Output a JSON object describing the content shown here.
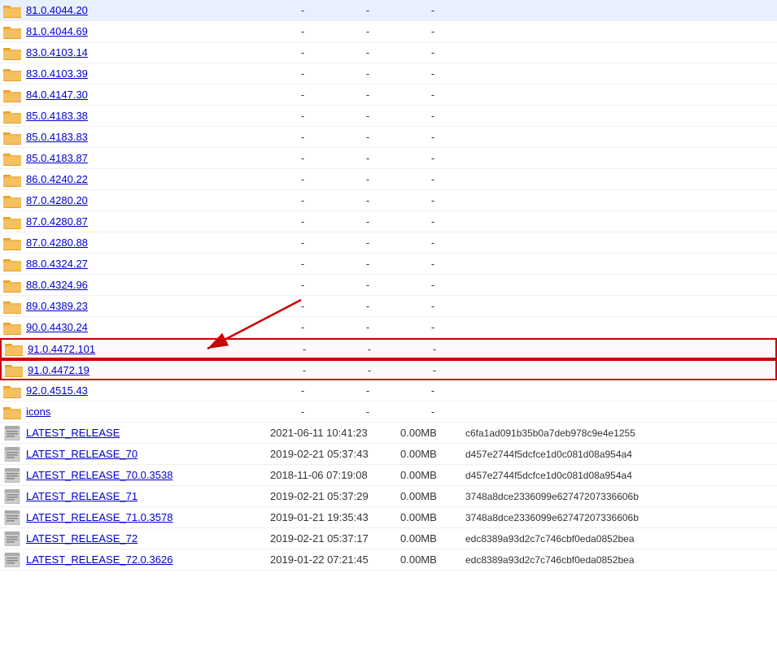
{
  "rows": [
    {
      "type": "folder",
      "name": "81.0.4044.20",
      "date": "",
      "size": "",
      "col3": "-",
      "col4": "-",
      "col5": "-",
      "hash": ""
    },
    {
      "type": "folder",
      "name": "81.0.4044.69",
      "date": "",
      "size": "",
      "col3": "-",
      "col4": "-",
      "col5": "-",
      "hash": ""
    },
    {
      "type": "folder",
      "name": "83.0.4103.14",
      "date": "",
      "size": "",
      "col3": "-",
      "col4": "-",
      "col5": "-",
      "hash": ""
    },
    {
      "type": "folder",
      "name": "83.0.4103.39",
      "date": "",
      "size": "",
      "col3": "-",
      "col4": "-",
      "col5": "-",
      "hash": ""
    },
    {
      "type": "folder",
      "name": "84.0.4147.30",
      "date": "",
      "size": "",
      "col3": "-",
      "col4": "-",
      "col5": "-",
      "hash": ""
    },
    {
      "type": "folder",
      "name": "85.0.4183.38",
      "date": "",
      "size": "",
      "col3": "-",
      "col4": "-",
      "col5": "-",
      "hash": ""
    },
    {
      "type": "folder",
      "name": "85.0.4183.83",
      "date": "",
      "size": "",
      "col3": "-",
      "col4": "-",
      "col5": "-",
      "hash": ""
    },
    {
      "type": "folder",
      "name": "85.0.4183.87",
      "date": "",
      "size": "",
      "col3": "-",
      "col4": "-",
      "col5": "-",
      "hash": ""
    },
    {
      "type": "folder",
      "name": "86.0.4240.22",
      "date": "",
      "size": "",
      "col3": "-",
      "col4": "-",
      "col5": "-",
      "hash": ""
    },
    {
      "type": "folder",
      "name": "87.0.4280.20",
      "date": "",
      "size": "",
      "col3": "-",
      "col4": "-",
      "col5": "-",
      "hash": ""
    },
    {
      "type": "folder",
      "name": "87.0.4280.87",
      "date": "",
      "size": "",
      "col3": "-",
      "col4": "-",
      "col5": "-",
      "hash": ""
    },
    {
      "type": "folder",
      "name": "87.0.4280.88",
      "date": "",
      "size": "",
      "col3": "-",
      "col4": "-",
      "col5": "-",
      "hash": ""
    },
    {
      "type": "folder",
      "name": "88.0.4324.27",
      "date": "",
      "size": "",
      "col3": "-",
      "col4": "-",
      "col5": "-",
      "hash": ""
    },
    {
      "type": "folder",
      "name": "88.0.4324.96",
      "date": "",
      "size": "",
      "col3": "-",
      "col4": "-",
      "col5": "-",
      "hash": ""
    },
    {
      "type": "folder",
      "name": "89.0.4389.23",
      "date": "",
      "size": "",
      "col3": "-",
      "col4": "-",
      "col5": "-",
      "hash": ""
    },
    {
      "type": "folder",
      "name": "90.0.4430.24",
      "date": "",
      "size": "",
      "col3": "-",
      "col4": "-",
      "col5": "-",
      "hash": ""
    },
    {
      "type": "folder",
      "name": "91.0.4472.101",
      "date": "",
      "size": "",
      "col3": "-",
      "col4": "-",
      "col5": "-",
      "hash": "",
      "highlighted": true
    },
    {
      "type": "folder",
      "name": "91.0.4472.19",
      "date": "",
      "size": "",
      "col3": "-",
      "col4": "-",
      "col5": "-",
      "hash": "",
      "highlighted": true
    },
    {
      "type": "folder",
      "name": "92.0.4515.43",
      "date": "",
      "size": "",
      "col3": "-",
      "col4": "-",
      "col5": "-",
      "hash": ""
    },
    {
      "type": "folder",
      "name": "icons",
      "date": "",
      "size": "",
      "col3": "-",
      "col4": "-",
      "col5": "-",
      "hash": ""
    },
    {
      "type": "file",
      "name": "LATEST_RELEASE",
      "date": "2021-06-11 10:41:23",
      "size": "0.00MB",
      "col3": "",
      "col4": "",
      "col5": "",
      "hash": "c6fa1ad091b35b0a7deb978c9e4e1255"
    },
    {
      "type": "file",
      "name": "LATEST_RELEASE_70",
      "date": "2019-02-21 05:37:43",
      "size": "0.00MB",
      "col3": "",
      "col4": "",
      "col5": "",
      "hash": "d457e2744f5dcfce1d0c081d08a954a4"
    },
    {
      "type": "file",
      "name": "LATEST_RELEASE_70.0.3538",
      "date": "2018-11-06 07:19:08",
      "size": "0.00MB",
      "col3": "",
      "col4": "",
      "col5": "",
      "hash": "d457e2744f5dcfce1d0c081d08a954a4"
    },
    {
      "type": "file",
      "name": "LATEST_RELEASE_71",
      "date": "2019-02-21 05:37:29",
      "size": "0.00MB",
      "col3": "",
      "col4": "",
      "col5": "",
      "hash": "3748a8dce2336099e62747207336606b"
    },
    {
      "type": "file",
      "name": "LATEST_RELEASE_71.0.3578",
      "date": "2019-01-21 19:35:43",
      "size": "0.00MB",
      "col3": "",
      "col4": "",
      "col5": "",
      "hash": "3748a8dce2336099e62747207336606b"
    },
    {
      "type": "file",
      "name": "LATEST_RELEASE_72",
      "date": "2019-02-21 05:37:17",
      "size": "0.00MB",
      "col3": "",
      "col4": "",
      "col5": "",
      "hash": "edc8389a93d2c7c746cbf0eda0852bea"
    },
    {
      "type": "file",
      "name": "LATEST_RELEASE_72.0.3626",
      "date": "2019-01-22 07:21:45",
      "size": "0.00MB",
      "col3": "",
      "col4": "",
      "col5": "",
      "hash": "edc8389a93d2c7c746cbf0eda0852bea"
    }
  ],
  "arrow": {
    "visible": true
  }
}
